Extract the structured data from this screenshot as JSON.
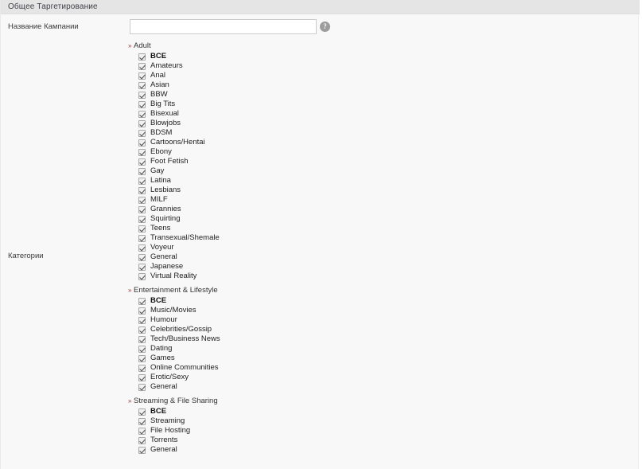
{
  "section": {
    "header_title": "Общее Таргетирование"
  },
  "campaign_name": {
    "label": "Название Кампании",
    "value": "",
    "placeholder": "",
    "help_icon": "help-circle-icon",
    "help_glyph": "?"
  },
  "categories": {
    "label": "Категории",
    "marker_glyph": "»",
    "groups": [
      {
        "title": "Adult",
        "items": [
          {
            "label": "BCE",
            "checked": true,
            "is_all": true
          },
          {
            "label": "Amateurs",
            "checked": true,
            "is_all": false
          },
          {
            "label": "Anal",
            "checked": true,
            "is_all": false
          },
          {
            "label": "Asian",
            "checked": true,
            "is_all": false
          },
          {
            "label": "BBW",
            "checked": true,
            "is_all": false
          },
          {
            "label": "Big Tits",
            "checked": true,
            "is_all": false
          },
          {
            "label": "Bisexual",
            "checked": true,
            "is_all": false
          },
          {
            "label": "Blowjobs",
            "checked": true,
            "is_all": false
          },
          {
            "label": "BDSM",
            "checked": true,
            "is_all": false
          },
          {
            "label": "Cartoons/Hentai",
            "checked": true,
            "is_all": false
          },
          {
            "label": "Ebony",
            "checked": true,
            "is_all": false
          },
          {
            "label": "Foot Fetish",
            "checked": true,
            "is_all": false
          },
          {
            "label": "Gay",
            "checked": true,
            "is_all": false
          },
          {
            "label": "Latina",
            "checked": true,
            "is_all": false
          },
          {
            "label": "Lesbians",
            "checked": true,
            "is_all": false
          },
          {
            "label": "MILF",
            "checked": true,
            "is_all": false
          },
          {
            "label": "Grannies",
            "checked": true,
            "is_all": false
          },
          {
            "label": "Squirting",
            "checked": true,
            "is_all": false
          },
          {
            "label": "Teens",
            "checked": true,
            "is_all": false
          },
          {
            "label": "Transexual/Shemale",
            "checked": true,
            "is_all": false
          },
          {
            "label": "Voyeur",
            "checked": true,
            "is_all": false
          },
          {
            "label": "General",
            "checked": true,
            "is_all": false
          },
          {
            "label": "Japanese",
            "checked": true,
            "is_all": false
          },
          {
            "label": "Virtual Reality",
            "checked": true,
            "is_all": false
          }
        ]
      },
      {
        "title": "Entertainment & Lifestyle",
        "items": [
          {
            "label": "BCE",
            "checked": true,
            "is_all": true
          },
          {
            "label": "Music/Movies",
            "checked": true,
            "is_all": false
          },
          {
            "label": "Humour",
            "checked": true,
            "is_all": false
          },
          {
            "label": "Celebrities/Gossip",
            "checked": true,
            "is_all": false
          },
          {
            "label": "Tech/Business News",
            "checked": true,
            "is_all": false
          },
          {
            "label": "Dating",
            "checked": true,
            "is_all": false
          },
          {
            "label": "Games",
            "checked": true,
            "is_all": false
          },
          {
            "label": "Online Communities",
            "checked": true,
            "is_all": false
          },
          {
            "label": "Erotic/Sexy",
            "checked": true,
            "is_all": false
          },
          {
            "label": "General",
            "checked": true,
            "is_all": false
          }
        ]
      },
      {
        "title": "Streaming & File Sharing",
        "items": [
          {
            "label": "BCE",
            "checked": true,
            "is_all": true
          },
          {
            "label": "Streaming",
            "checked": true,
            "is_all": false
          },
          {
            "label": "File Hosting",
            "checked": true,
            "is_all": false
          },
          {
            "label": "Torrents",
            "checked": true,
            "is_all": false
          },
          {
            "label": "General",
            "checked": true,
            "is_all": false
          }
        ]
      }
    ]
  },
  "colors": {
    "header_bar": "#e5e5e5",
    "panel_bg": "#f8f8f8",
    "marker": "#8c3a3a",
    "help_icon_bg": "#9c9c9c"
  }
}
